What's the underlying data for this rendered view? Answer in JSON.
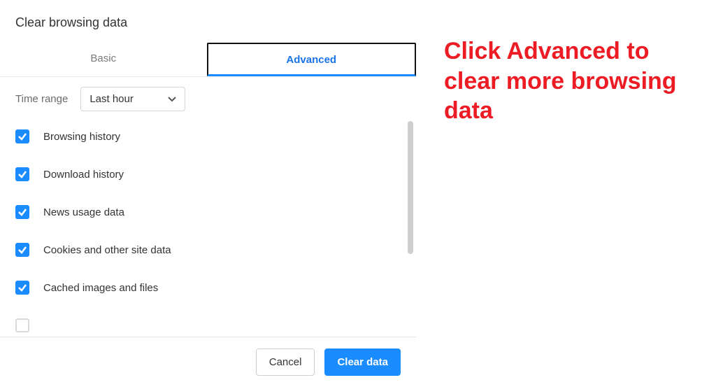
{
  "dialog": {
    "title": "Clear browsing data",
    "tabs": {
      "basic": "Basic",
      "advanced": "Advanced"
    },
    "timeRange": {
      "label": "Time range",
      "value": "Last hour"
    },
    "items": [
      {
        "label": "Browsing history",
        "checked": true
      },
      {
        "label": "Download history",
        "checked": true
      },
      {
        "label": "News usage data",
        "checked": true
      },
      {
        "label": "Cookies and other site data",
        "checked": true
      },
      {
        "label": "Cached images and files",
        "checked": true
      },
      {
        "label": "",
        "checked": false
      }
    ],
    "buttons": {
      "cancel": "Cancel",
      "clear": "Clear data"
    }
  },
  "annotation": "Click Advanced to clear more browsing data"
}
